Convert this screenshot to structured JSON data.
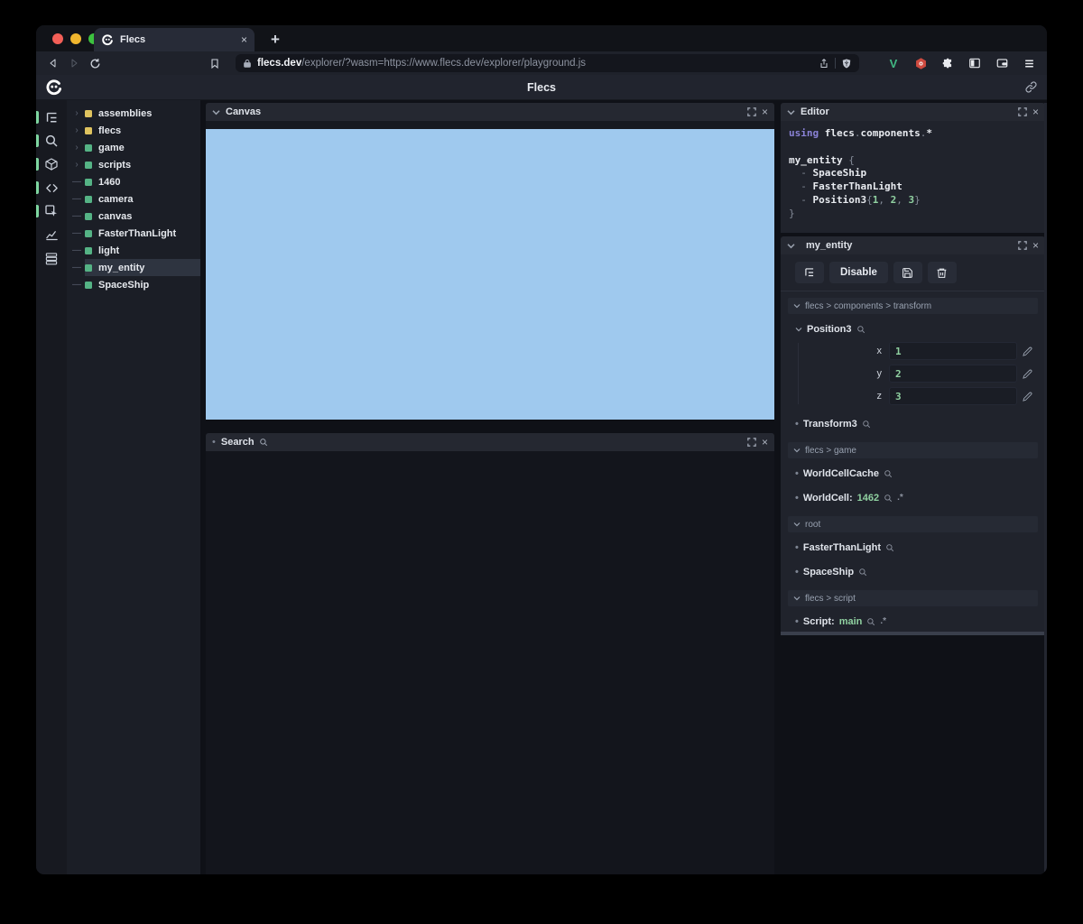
{
  "browser": {
    "tab_title": "Flecs",
    "tab_close": "×",
    "new_tab_label": "+",
    "url_domain": "flecs.dev",
    "url_path": "/explorer/?wasm=https://www.flecs.dev/explorer/playground.js"
  },
  "app": {
    "title": "Flecs"
  },
  "glyphs": {
    "bullet": "•"
  },
  "sidebar": {
    "icons": [
      {
        "name": "tree-view",
        "active": true
      },
      {
        "name": "search",
        "active": true
      },
      {
        "name": "entities",
        "active": true
      },
      {
        "name": "code",
        "active": true
      },
      {
        "name": "inspect",
        "active": true
      },
      {
        "name": "stats",
        "active": false
      },
      {
        "name": "tables",
        "active": false
      }
    ]
  },
  "tree": {
    "items": [
      {
        "label": "assemblies",
        "marker": "›",
        "kind": "module"
      },
      {
        "label": "flecs",
        "marker": "›",
        "kind": "module"
      },
      {
        "label": "game",
        "marker": "›",
        "kind": "entity"
      },
      {
        "label": "scripts",
        "marker": "›",
        "kind": "entity"
      },
      {
        "label": "1460",
        "marker": "—",
        "kind": "entity"
      },
      {
        "label": "camera",
        "marker": "—",
        "kind": "entity"
      },
      {
        "label": "canvas",
        "marker": "—",
        "kind": "entity"
      },
      {
        "label": "FasterThanLight",
        "marker": "—",
        "kind": "entity"
      },
      {
        "label": "light",
        "marker": "—",
        "kind": "entity"
      },
      {
        "label": "my_entity",
        "marker": "—",
        "kind": "entity",
        "selected": true
      },
      {
        "label": "SpaceShip",
        "marker": "—",
        "kind": "entity"
      }
    ]
  },
  "canvas_panel": {
    "title": "Canvas",
    "close": "×"
  },
  "search_panel": {
    "title": "Search",
    "close": "×"
  },
  "editor_panel": {
    "title": "Editor",
    "close": "×",
    "code": {
      "using_kw": "using",
      "using_ns": "flecs",
      "dot": ".",
      "using_mod": "components",
      "wildcard": "*",
      "entity_name": "my_entity",
      "brace_open": "{",
      "brace_close": "}",
      "dash": "-",
      "tag1": "SpaceShip",
      "tag2": "FasterThanLight",
      "component": "Position3",
      "arg_open": "{",
      "arg1": "1",
      "comma1": ",",
      "arg2": "2",
      "comma2": ",",
      "arg3": "3",
      "arg_close": "}"
    }
  },
  "inspector": {
    "title": "my_entity",
    "close": "×",
    "toolbar": {
      "disable_label": "Disable"
    },
    "sections": [
      {
        "path": "flecs > components > transform",
        "position3": {
          "name": "Position3",
          "fields": [
            {
              "key": "x",
              "value": "1"
            },
            {
              "key": "y",
              "value": "2"
            },
            {
              "key": "z",
              "value": "3"
            }
          ]
        },
        "transform3": {
          "name": "Transform3"
        }
      },
      {
        "path": "flecs > game",
        "items": [
          {
            "name": "WorldCellCache"
          },
          {
            "name": "WorldCell:",
            "value": "1462",
            "suffix": ".*"
          }
        ]
      },
      {
        "path": "root",
        "items": [
          {
            "name": "FasterThanLight"
          },
          {
            "name": "SpaceShip"
          }
        ]
      },
      {
        "path": "flecs > script",
        "items": [
          {
            "name": "Script:",
            "value": "main",
            "suffix": ".*"
          }
        ]
      }
    ]
  },
  "colors": {
    "module_yellow": "#dfc35f",
    "entity_green": "#55b385",
    "value_green": "#90d1a1",
    "keyword_purple": "#8a82d6",
    "canvas_blue": "#9fc9ee"
  }
}
